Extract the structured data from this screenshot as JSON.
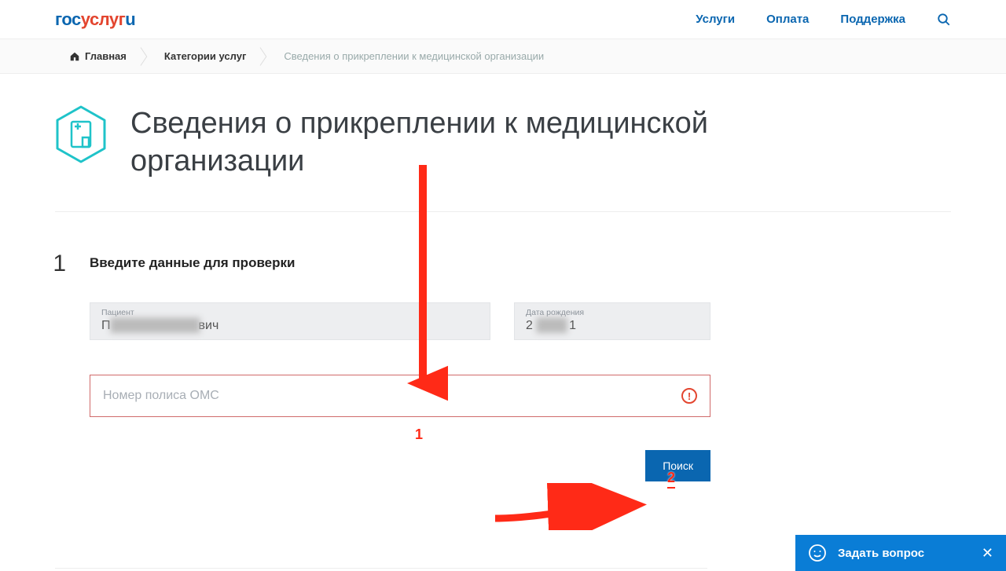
{
  "logo": {
    "p1": "гос",
    "p2": "услуг",
    "p3": "u"
  },
  "nav": {
    "services": "Услуги",
    "payment": "Оплата",
    "support": "Поддержка"
  },
  "breadcrumb": {
    "home": "Главная",
    "categories": "Категории услуг",
    "current": "Сведения о прикреплении к медицинской организации"
  },
  "page_title": "Сведения о прикреплении к медицинской организации",
  "step": {
    "num": "1",
    "title": "Введите данные для проверки"
  },
  "fields": {
    "patient_label": "Пациент",
    "patient_value_prefix": "П",
    "patient_value_suffix": "вич",
    "dob_label": "Дата рождения",
    "dob_value_prefix": "2",
    "dob_value_suffix": "1",
    "oms_placeholder": "Номер полиса ОМС"
  },
  "buttons": {
    "search": "Поиск"
  },
  "annotations": {
    "n1": "1",
    "n2": "2"
  },
  "chat": {
    "label": "Задать вопрос",
    "close": "✕"
  }
}
